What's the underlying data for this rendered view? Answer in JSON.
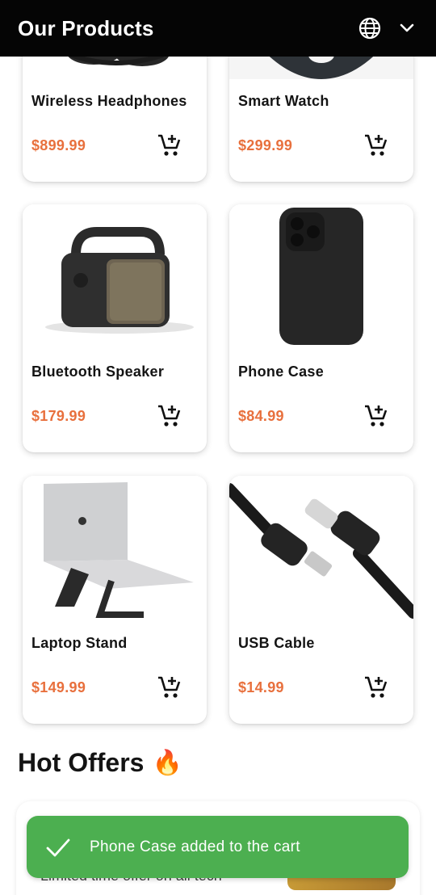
{
  "header": {
    "title": "Our Products",
    "language_icon": "globe-icon",
    "dropdown_icon": "chevron-down-icon"
  },
  "products": [
    {
      "name": "Wireless Headphones",
      "price": "$899.99",
      "image": "headphones",
      "cart_icon": "add-cart-icon"
    },
    {
      "name": "Smart Watch",
      "price": "$299.99",
      "image": "smart-watch",
      "cart_icon": "add-cart-icon"
    },
    {
      "name": "Bluetooth Speaker",
      "price": "$179.99",
      "image": "speaker",
      "cart_icon": "add-cart-icon"
    },
    {
      "name": "Phone Case",
      "price": "$84.99",
      "image": "phone-case",
      "cart_icon": "add-cart-icon"
    },
    {
      "name": "Laptop Stand",
      "price": "$149.99",
      "image": "laptop-stand",
      "cart_icon": "add-cart-icon"
    },
    {
      "name": "USB Cable",
      "price": "$14.99",
      "image": "usb-cable",
      "cart_icon": "add-cart-icon"
    }
  ],
  "hot_offers": {
    "title": "Hot Offers",
    "emoji": "🔥",
    "offer_text": "Limited time offer on all tech"
  },
  "snackbar": {
    "message": "Phone Case added to the cart",
    "icon": "check-icon"
  },
  "colors": {
    "header_bg": "#050505",
    "price": "#e8703d",
    "snackbar_bg": "#4caf50"
  }
}
